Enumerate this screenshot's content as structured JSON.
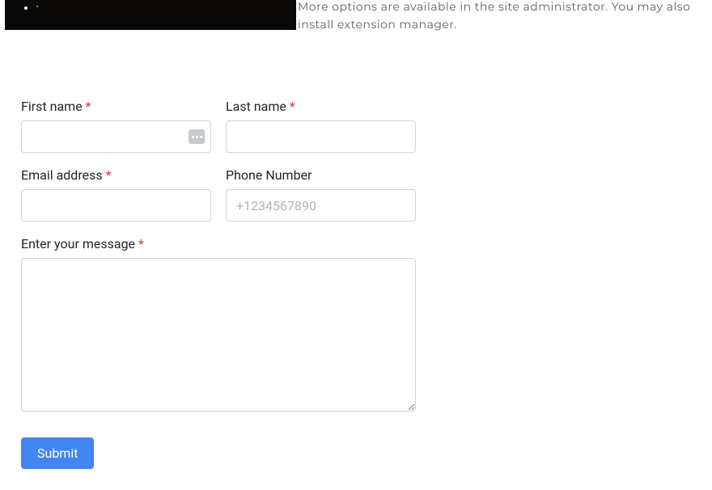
{
  "intro": "More options are available in the site administrator. You may also install extension manager.",
  "form": {
    "first_name": {
      "label": "First name",
      "required_marker": "*"
    },
    "last_name": {
      "label": "Last name",
      "required_marker": "*"
    },
    "email": {
      "label": "Email address",
      "required_marker": "*"
    },
    "phone": {
      "label": "Phone Number",
      "placeholder": "+1234567890"
    },
    "message": {
      "label": "Enter your message",
      "required_marker": "*"
    },
    "submit_label": "Submit"
  }
}
